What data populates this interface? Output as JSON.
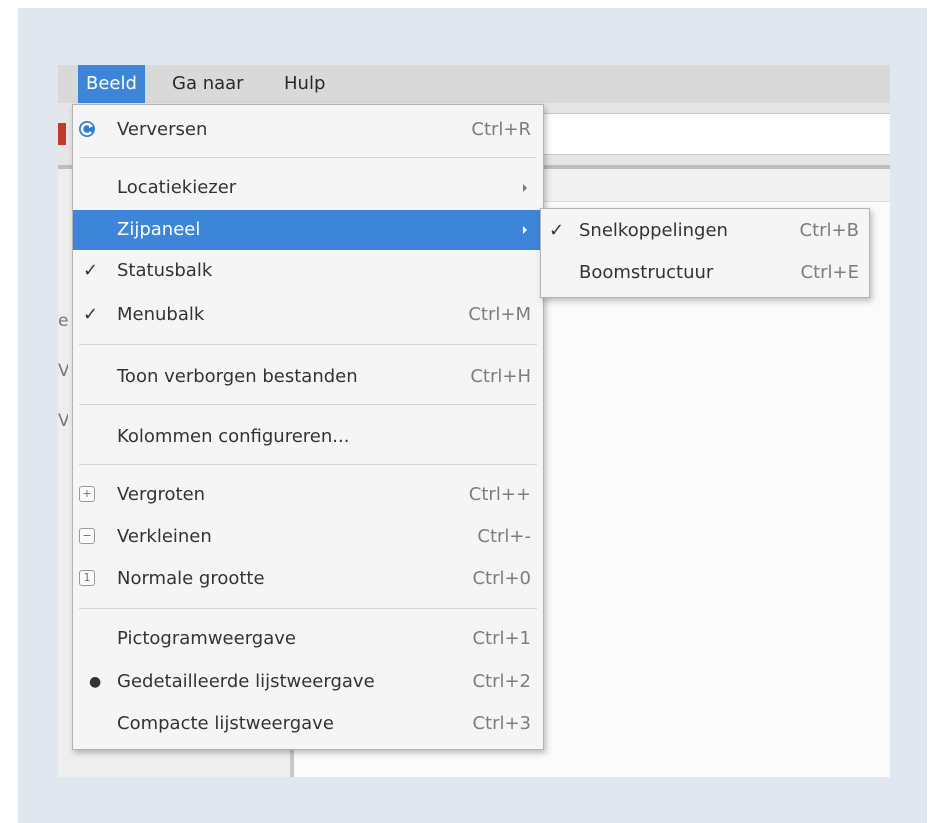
{
  "menubar": {
    "items": [
      {
        "label": "Beeld"
      },
      {
        "label": "Ga naar"
      },
      {
        "label": "Hulp"
      }
    ]
  },
  "sidebar": {
    "fragments": [
      "er",
      "V",
      "V"
    ]
  },
  "menu": {
    "refresh": {
      "label": "Verversen",
      "shortcut": "Ctrl+R",
      "icon": "refresh-icon"
    },
    "location_picker": {
      "label": "Locatiekiezer"
    },
    "side_panel": {
      "label": "Zijpaneel"
    },
    "statusbar": {
      "label": "Statusbalk",
      "checked": true
    },
    "menubar": {
      "label": "Menubalk",
      "shortcut": "Ctrl+M",
      "checked": true
    },
    "show_hidden": {
      "label": "Toon verborgen bestanden",
      "shortcut": "Ctrl+H"
    },
    "configure_columns": {
      "label": "Kolommen configureren..."
    },
    "zoom_in": {
      "label": "Vergroten",
      "shortcut": "Ctrl++",
      "icon": "zoom-in-icon"
    },
    "zoom_out": {
      "label": "Verkleinen",
      "shortcut": "Ctrl+-",
      "icon": "zoom-out-icon"
    },
    "zoom_normal": {
      "label": "Normale grootte",
      "shortcut": "Ctrl+0",
      "icon": "zoom-original-icon"
    },
    "icon_view": {
      "label": "Pictogramweergave",
      "shortcut": "Ctrl+1"
    },
    "detailed_list": {
      "label": "Gedetailleerde lijstweergave",
      "shortcut": "Ctrl+2",
      "selected": true
    },
    "compact_list": {
      "label": "Compacte lijstweergave",
      "shortcut": "Ctrl+3"
    }
  },
  "submenu": {
    "shortcuts": {
      "label": "Snelkoppelingen",
      "shortcut": "Ctrl+B",
      "checked": true
    },
    "tree": {
      "label": "Boomstructuur",
      "shortcut": "Ctrl+E"
    }
  },
  "colors": {
    "highlight": "#3d85d8",
    "menu_bg": "#f5f5f5",
    "page_bg": "#e1e7ef"
  }
}
